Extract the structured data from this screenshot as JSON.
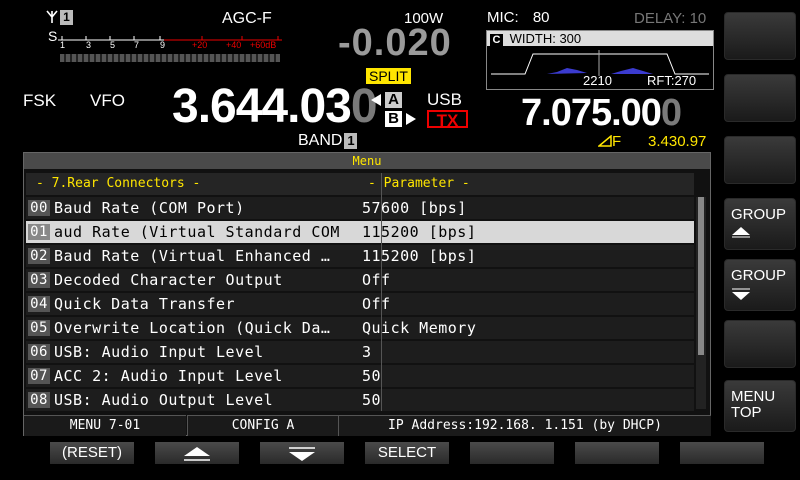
{
  "header": {
    "agc": "AGC-F",
    "power": "100W",
    "mic_label": "MIC:",
    "mic_value": "80",
    "delay": "DELAY: 10",
    "ant_number": "1"
  },
  "smeter": {
    "s_label": "S",
    "scale": [
      "1",
      "3",
      "5",
      "7",
      "9",
      "+20",
      "+40",
      "+60dB"
    ]
  },
  "rit": "-0.020",
  "split": "SPLIT",
  "scope": {
    "icon": "C",
    "width": "WIDTH: 300",
    "left_val": "2210",
    "right_val": "RFT:270"
  },
  "vfo_a": {
    "mode": "FSK",
    "vfo": "VFO",
    "freq_main": "3.644.03",
    "freq_dim": "0",
    "band_label": "BAND",
    "band_num": "1"
  },
  "ab": {
    "a": "A",
    "b": "B"
  },
  "sub": {
    "mode": "USB",
    "tx": "TX",
    "freq_main": "7.075.00",
    "freq_dim": "0",
    "delta_label": "F",
    "delta_value": "3.430.97"
  },
  "side_keys": [
    "",
    "",
    "",
    "GROUP",
    "GROUP",
    "",
    "MENU TOP"
  ],
  "menu": {
    "title": "Menu",
    "col_name": "- 7.Rear Connectors -",
    "col_param": "- Parameter -",
    "rows": [
      {
        "num": "00",
        "name": "Baud Rate (COM Port)",
        "value": "57600 [bps]"
      },
      {
        "num": "01",
        "name": "aud Rate (Virtual Standard COM",
        "value": "115200 [bps]"
      },
      {
        "num": "02",
        "name": "Baud Rate (Virtual Enhanced …",
        "value": "115200 [bps]"
      },
      {
        "num": "03",
        "name": "Decoded Character Output",
        "value": "Off"
      },
      {
        "num": "04",
        "name": "Quick Data Transfer",
        "value": "Off"
      },
      {
        "num": "05",
        "name": "Overwrite Location (Quick Da…",
        "value": "Quick Memory"
      },
      {
        "num": "06",
        "name": "USB: Audio Input Level",
        "value": "3"
      },
      {
        "num": "07",
        "name": "ACC 2: Audio Input Level",
        "value": "50"
      },
      {
        "num": "08",
        "name": "USB: Audio Output Level",
        "value": "50"
      }
    ],
    "status_menu": "MENU 7-01",
    "status_config": "CONFIG A",
    "status_ip": "IP Address:192.168.  1.151 (by DHCP)"
  },
  "bottom_keys": {
    "reset": "(RESET)",
    "select": "SELECT"
  }
}
